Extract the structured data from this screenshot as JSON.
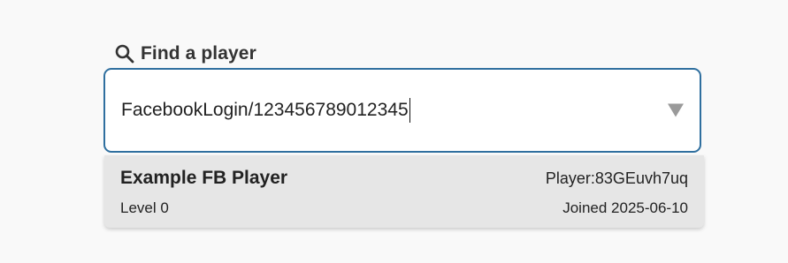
{
  "finder": {
    "label": "Find a player",
    "label_icon": "search-icon",
    "input_value": "FacebookLogin/123456789012345",
    "dropdown_icon": "triangle-down-icon"
  },
  "results": [
    {
      "name": "Example FB Player",
      "player_id": "Player:83GEuvh7uq",
      "level": "Level 0",
      "joined": "Joined 2025-06-10"
    }
  ],
  "colors": {
    "background": "#f9f9f9",
    "border_accent": "#2f6f9f",
    "dropdown_bg": "#e6e6e6",
    "arrow": "#9a9a9a"
  }
}
